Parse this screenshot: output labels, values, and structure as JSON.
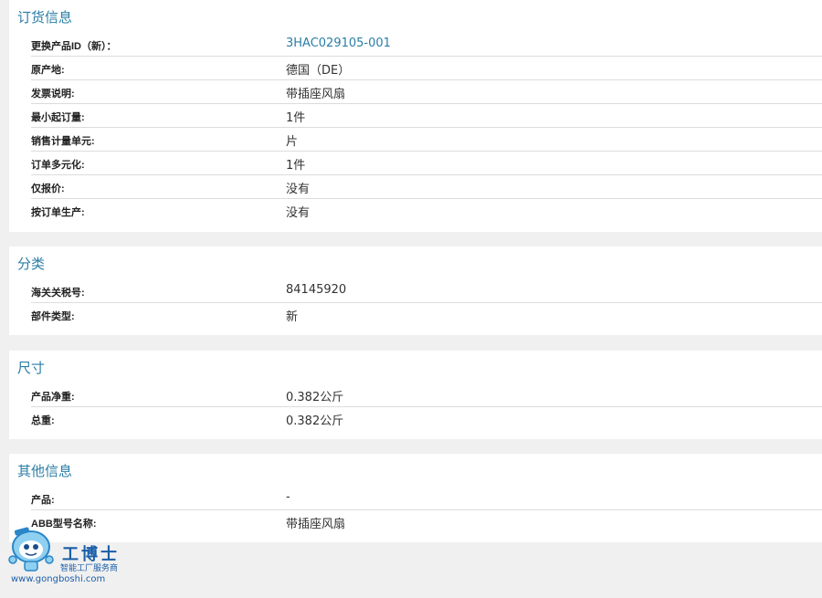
{
  "ordering": {
    "title": "订货信息",
    "rows": [
      {
        "label": "更换产品ID（新）：",
        "value": "3HAC029105-001"
      },
      {
        "label": "原产地:",
        "value": "德国（DE）"
      },
      {
        "label": "发票说明:",
        "value": "带插座风扇"
      },
      {
        "label": "最小起订量:",
        "value": "1件"
      },
      {
        "label": "销售计量单元:",
        "value": "片"
      },
      {
        "label": "订单多元化:",
        "value": "1件"
      },
      {
        "label": "仅报价:",
        "value": "没有"
      },
      {
        "label": "按订单生产:",
        "value": "没有"
      }
    ]
  },
  "classification": {
    "title": "分类",
    "rows": [
      {
        "label": "海关关税号:",
        "value": "84145920"
      },
      {
        "label": "部件类型:",
        "value": "新"
      }
    ]
  },
  "dimensions": {
    "title": "尺寸",
    "rows": [
      {
        "label": "产品净重:",
        "value": "0.382公斤"
      },
      {
        "label": "总重:",
        "value": "0.382公斤"
      }
    ]
  },
  "other": {
    "title": "其他信息",
    "rows": [
      {
        "label": "产品:",
        "value": "-"
      },
      {
        "label": "ABB型号名称:",
        "value": "带插座风扇"
      }
    ]
  },
  "watermark": {
    "brand": "工博士",
    "tagline": "智能工厂服务商",
    "url": "www.gongboshi.com",
    "icon": "robot-mascot-icon"
  },
  "colors": {
    "accent": "#2a7ea6",
    "background": "#f0f0f0",
    "card": "#ffffff",
    "divider": "#dcdcdc"
  }
}
